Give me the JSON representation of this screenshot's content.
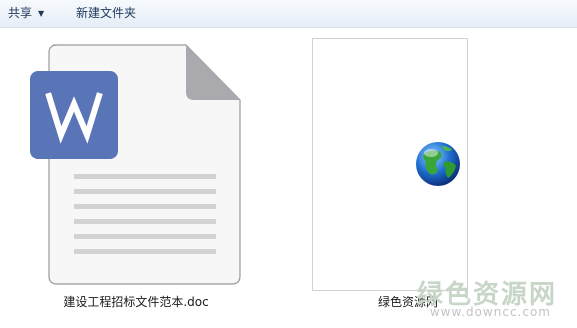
{
  "toolbar": {
    "share_label": "共享",
    "new_folder_label": "新建文件夹"
  },
  "files": [
    {
      "name": "建设工程招标文件范本.doc",
      "icon": "wps-document-icon",
      "icon_color": "#5a74b8"
    },
    {
      "name": "绿色资源网",
      "icon": "globe-internet-shortcut-icon"
    }
  ],
  "watermark": {
    "brand": "绿色资源网",
    "url": "www.downcc.com"
  }
}
